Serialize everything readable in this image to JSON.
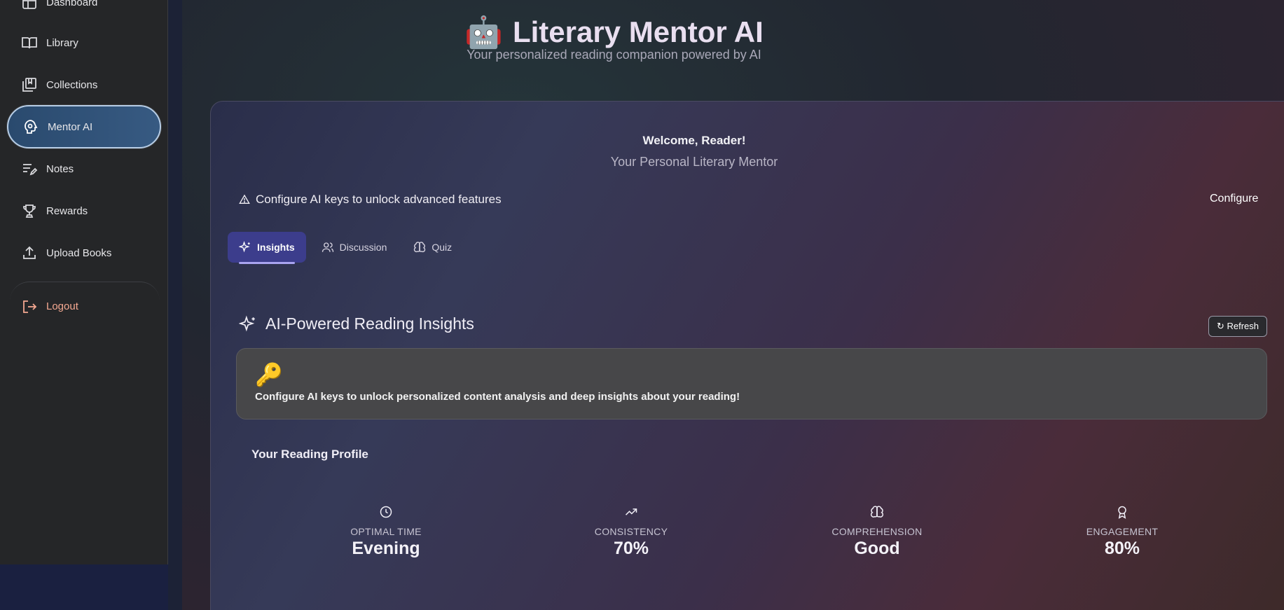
{
  "sidebar": {
    "items": [
      {
        "label": "Dashboard",
        "icon": "dashboard-icon"
      },
      {
        "label": "Library",
        "icon": "book-open-icon"
      },
      {
        "label": "Collections",
        "icon": "collections-icon"
      },
      {
        "label": "Mentor AI",
        "icon": "mentor-ai-icon",
        "active": true
      },
      {
        "label": "Notes",
        "icon": "notes-icon"
      },
      {
        "label": "Rewards",
        "icon": "trophy-icon"
      },
      {
        "label": "Upload Books",
        "icon": "upload-icon"
      }
    ],
    "logout_label": "Logout"
  },
  "header": {
    "title": "Literary Mentor AI",
    "emoji": "🤖",
    "subtitle": "Your personalized reading companion powered by AI"
  },
  "card": {
    "welcome": "Welcome, Reader!",
    "welcome_sub": "Your Personal Literary Mentor",
    "warning": "Configure AI keys to unlock advanced features",
    "configure_label": "Configure",
    "tabs": [
      {
        "label": "Insights",
        "icon": "sparkles-icon",
        "active": true
      },
      {
        "label": "Discussion",
        "icon": "users-icon"
      },
      {
        "label": "Quiz",
        "icon": "brain-icon"
      }
    ],
    "section_title": "AI-Powered Reading Insights",
    "refresh_label": "↻ Refresh",
    "notice": {
      "emoji": "🔑",
      "text": "Configure AI keys to unlock personalized content analysis and deep insights about your reading!"
    },
    "profile_title": "Your Reading Profile",
    "stats": [
      {
        "label": "OPTIMAL TIME",
        "value": "Evening",
        "icon": "clock-icon"
      },
      {
        "label": "CONSISTENCY",
        "value": "70%",
        "icon": "trending-up-icon"
      },
      {
        "label": "COMPREHENSION",
        "value": "Good",
        "icon": "brain-icon"
      },
      {
        "label": "ENGAGEMENT",
        "value": "80%",
        "icon": "award-icon"
      }
    ]
  },
  "colors": {
    "active_tab": "#3c3d8c",
    "logout": "#f4a891",
    "active_nav": "#375a82"
  }
}
